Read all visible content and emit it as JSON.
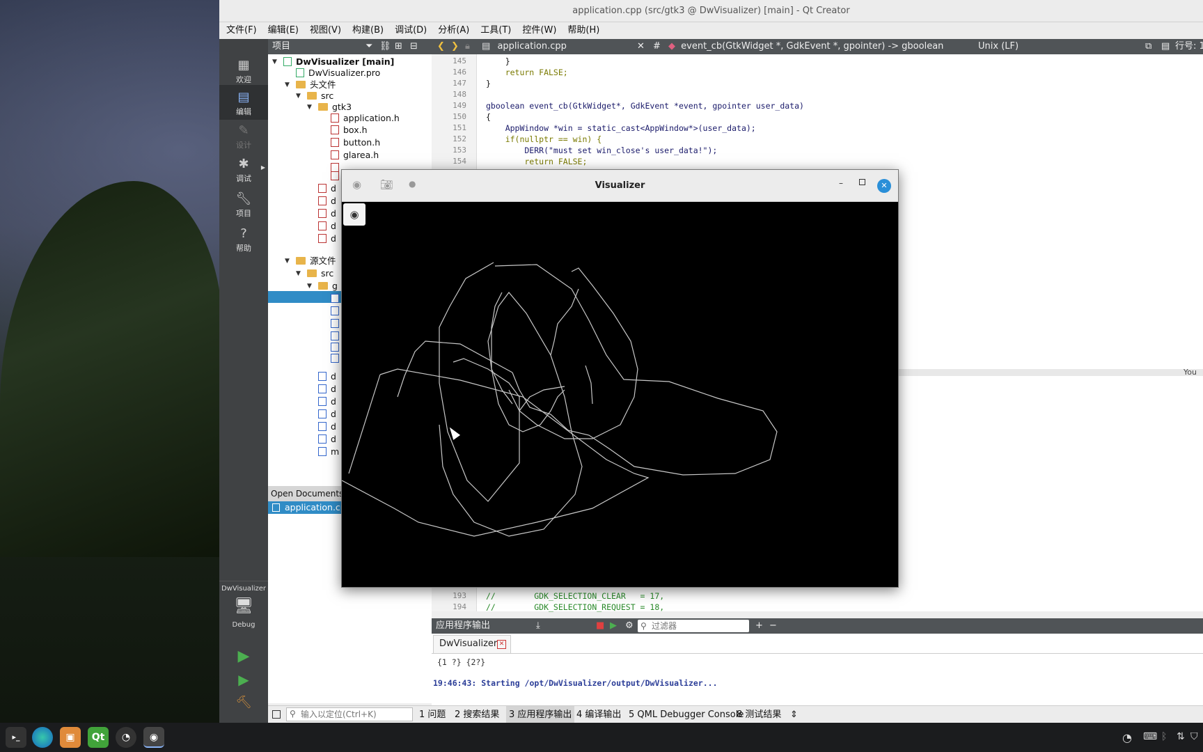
{
  "window": {
    "title": "application.cpp (src/gtk3 @ DwVisualizer) [main] - Qt Creator"
  },
  "menus": [
    "文件(F)",
    "编辑(E)",
    "视图(V)",
    "构建(B)",
    "调试(D)",
    "分析(A)",
    "工具(T)",
    "控件(W)",
    "帮助(H)"
  ],
  "modes": [
    {
      "label": "欢迎",
      "icon": "grid-icon"
    },
    {
      "label": "编辑",
      "icon": "edit-icon"
    },
    {
      "label": "设计",
      "icon": "pen-icon"
    },
    {
      "label": "调试",
      "icon": "bug-icon"
    },
    {
      "label": "项目",
      "icon": "wrench-icon"
    },
    {
      "label": "帮助",
      "icon": "help-icon"
    }
  ],
  "kit": {
    "project": "DwVisualizer",
    "build": "Debug"
  },
  "project_pane": {
    "title": "项目"
  },
  "tree": [
    {
      "text": "DwVisualizer [main]",
      "indent": 0,
      "kind": "project",
      "bold": true
    },
    {
      "text": "DwVisualizer.pro",
      "indent": 1,
      "kind": "file"
    },
    {
      "text": "头文件",
      "indent": 1,
      "kind": "folder"
    },
    {
      "text": "src",
      "indent": 2,
      "kind": "folder"
    },
    {
      "text": "gtk3",
      "indent": 3,
      "kind": "folder"
    },
    {
      "text": "application.h",
      "indent": 4,
      "kind": "file"
    },
    {
      "text": "box.h",
      "indent": 4,
      "kind": "file"
    },
    {
      "text": "button.h",
      "indent": 4,
      "kind": "file"
    },
    {
      "text": "glarea.h",
      "indent": 4,
      "kind": "file"
    },
    {
      "text": "",
      "indent": 4,
      "kind": "file"
    },
    {
      "text": "",
      "indent": 4,
      "kind": "file"
    },
    {
      "text": "d",
      "indent": 3,
      "kind": "file"
    },
    {
      "text": "d",
      "indent": 3,
      "kind": "file"
    },
    {
      "text": "d",
      "indent": 3,
      "kind": "file"
    },
    {
      "text": "d",
      "indent": 3,
      "kind": "file"
    },
    {
      "text": "d",
      "indent": 3,
      "kind": "file"
    },
    {
      "text": "源文件",
      "indent": 1,
      "kind": "folder"
    },
    {
      "text": "src",
      "indent": 2,
      "kind": "folder"
    },
    {
      "text": "g",
      "indent": 3,
      "kind": "folder"
    },
    {
      "text": "",
      "indent": 4,
      "kind": "file"
    },
    {
      "text": "",
      "indent": 4,
      "kind": "file"
    },
    {
      "text": "",
      "indent": 4,
      "kind": "file"
    },
    {
      "text": "",
      "indent": 4,
      "kind": "file"
    },
    {
      "text": "",
      "indent": 4,
      "kind": "file"
    },
    {
      "text": "",
      "indent": 4,
      "kind": "file"
    },
    {
      "text": "d",
      "indent": 3,
      "kind": "file"
    },
    {
      "text": "d",
      "indent": 3,
      "kind": "file"
    },
    {
      "text": "d",
      "indent": 3,
      "kind": "file"
    },
    {
      "text": "d",
      "indent": 3,
      "kind": "file"
    },
    {
      "text": "d",
      "indent": 3,
      "kind": "file"
    },
    {
      "text": "d",
      "indent": 3,
      "kind": "file"
    },
    {
      "text": "m",
      "indent": 3,
      "kind": "file"
    }
  ],
  "open_docs": {
    "title": "Open Documents",
    "items": [
      "application.cpp"
    ]
  },
  "editor": {
    "file_tab": "application.cpp",
    "symbol": "event_cb(GtkWidget *, GdkEvent *, gpointer) -> gboolean",
    "line_ending": "Unix (LF)",
    "hash": "#",
    "position": "行号: 1",
    "right_cut": "You",
    "lines_top": [
      {
        "n": "145",
        "code": "    }"
      },
      {
        "n": "146",
        "code": "    return FALSE;"
      },
      {
        "n": "147",
        "code": "}"
      },
      {
        "n": "148",
        "code": ""
      },
      {
        "n": "149",
        "code": "gboolean event_cb(GtkWidget*, GdkEvent *event, gpointer user_data)"
      },
      {
        "n": "150",
        "code": "{"
      },
      {
        "n": "151",
        "code": "    AppWindow *win = static_cast<AppWindow*>(user_data);"
      },
      {
        "n": "152",
        "code": "    if(nullptr == win) {"
      },
      {
        "n": "153",
        "code": "        DERR(\"must set win_close's user_data!\");"
      },
      {
        "n": "154",
        "code": "        return FALSE;"
      }
    ],
    "lines_bottom": [
      {
        "n": "193",
        "code": "//        GDK_SELECTION_CLEAR   = 17,"
      },
      {
        "n": "194",
        "code": "//        GDK_SELECTION_REQUEST = 18,"
      }
    ]
  },
  "output": {
    "title": "应用程序输出",
    "filter_placeholder": "过滤器",
    "tab": "DwVisualizer",
    "lines": [
      "{1 ?} {2?}",
      "19:46:43: Starting /opt/DwVisualizer/output/DwVisualizer..."
    ]
  },
  "status": {
    "locator_placeholder": "输入以定位(Ctrl+K)",
    "panes": [
      "1  问题",
      "2  搜索结果",
      "3  应用程序输出",
      "4  编译输出",
      "5  QML Debugger Console",
      "8  测试结果"
    ]
  },
  "visualizer": {
    "title": "Visualizer"
  },
  "taskbar": {
    "apps": [
      "terminal-icon",
      "edge-icon",
      "files-icon",
      "qt-icon",
      "obs-icon",
      "visualizer-icon"
    ],
    "qt_label": "Qt"
  },
  "colors": {
    "accent": "#308cc6",
    "mode_bar": "#404244",
    "close": "#2a8fd8"
  }
}
